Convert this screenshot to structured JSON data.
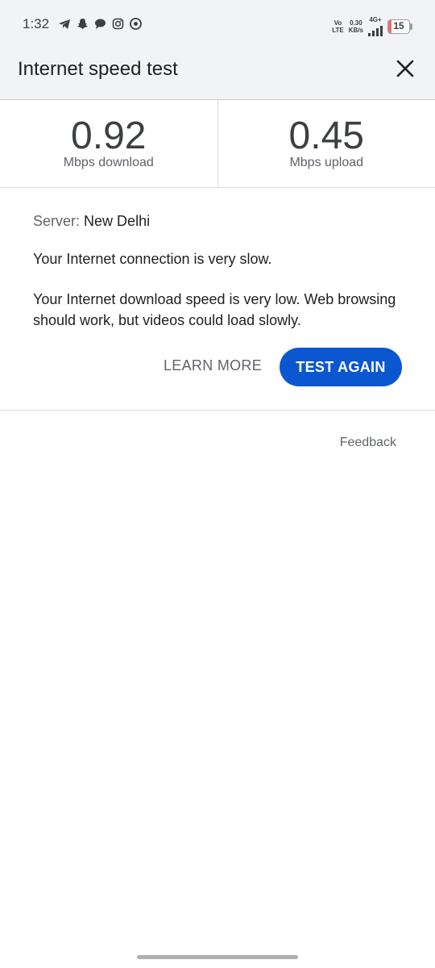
{
  "status_bar": {
    "time": "1:32",
    "volte_top": "Vo",
    "volte_bottom": "LTE",
    "speed_value": "0.30",
    "speed_unit": "KB/s",
    "network": "4G+",
    "battery": "15",
    "battery_level_percent": 15,
    "battery_color": "#e8716d",
    "icons": [
      "telegram-icon",
      "snapchat-icon",
      "chat-icon",
      "instagram-icon",
      "circle-app-icon"
    ]
  },
  "header": {
    "title": "Internet speed test",
    "close_icon": "close-icon"
  },
  "speeds": {
    "download_value": "0.92",
    "download_unit": "Mbps download",
    "upload_value": "0.45",
    "upload_unit": "Mbps upload"
  },
  "result": {
    "server_label": "Server:",
    "server_value": "New Delhi",
    "message_1": "Your Internet connection is very slow.",
    "message_2": "Your Internet download speed is very low. Web browsing should work, but videos could load slowly.",
    "learn_more_label": "LEARN MORE",
    "test_again_label": "TEST AGAIN"
  },
  "feedback_label": "Feedback",
  "colors": {
    "accent": "#0b57d0",
    "header_bg": "#f1f3f4"
  }
}
